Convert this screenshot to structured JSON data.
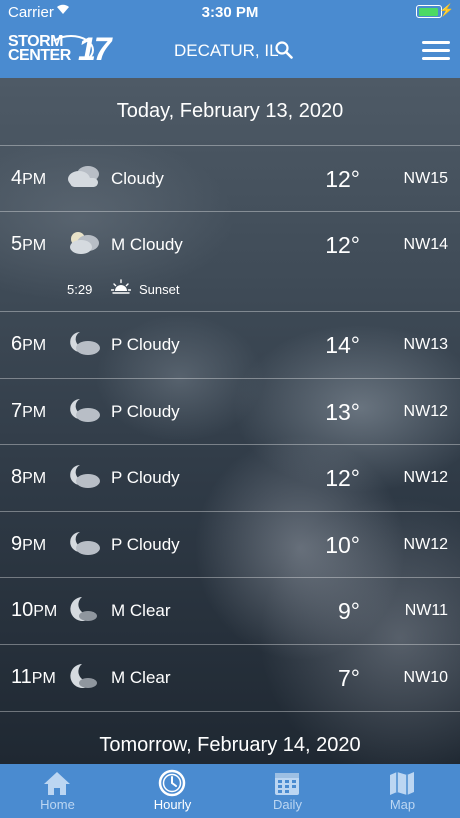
{
  "status": {
    "carrier": "Carrier",
    "time": "3:30 PM"
  },
  "header": {
    "logo_line1": "STORM",
    "logo_line2": "CENTER",
    "logo_number": "17",
    "location": "DECATUR, IL",
    "icons": {
      "search": "search-icon",
      "menu": "menu-icon"
    }
  },
  "today_header": "Today, February 13, 2020",
  "tomorrow_header": "Tomorrow, February 14, 2020",
  "hours": [
    {
      "hour": "4",
      "ampm": "PM",
      "icon": "cloudy-icon",
      "condition": "Cloudy",
      "temp": "12°",
      "wind": "NW15"
    },
    {
      "hour": "5",
      "ampm": "PM",
      "icon": "mostly-cloudy-day-icon",
      "condition": "M Cloudy",
      "temp": "12°",
      "wind": "NW14"
    },
    {
      "hour": "6",
      "ampm": "PM",
      "icon": "partly-cloudy-night-icon",
      "condition": "P Cloudy",
      "temp": "14°",
      "wind": "NW13"
    },
    {
      "hour": "7",
      "ampm": "PM",
      "icon": "partly-cloudy-night-icon",
      "condition": "P Cloudy",
      "temp": "13°",
      "wind": "NW12"
    },
    {
      "hour": "8",
      "ampm": "PM",
      "icon": "partly-cloudy-night-icon",
      "condition": "P Cloudy",
      "temp": "12°",
      "wind": "NW12"
    },
    {
      "hour": "9",
      "ampm": "PM",
      "icon": "partly-cloudy-night-icon",
      "condition": "P Cloudy",
      "temp": "10°",
      "wind": "NW12"
    },
    {
      "hour": "10",
      "ampm": "PM",
      "icon": "mostly-clear-night-icon",
      "condition": "M Clear",
      "temp": "9°",
      "wind": "NW11"
    },
    {
      "hour": "11",
      "ampm": "PM",
      "icon": "mostly-clear-night-icon",
      "condition": "M Clear",
      "temp": "7°",
      "wind": "NW10"
    }
  ],
  "sunset": {
    "time": "5:29",
    "label": "Sunset",
    "icon": "sunset-icon"
  },
  "tabs": [
    {
      "label": "Home",
      "icon": "home-icon",
      "active": false
    },
    {
      "label": "Hourly",
      "icon": "clock-icon",
      "active": true
    },
    {
      "label": "Daily",
      "icon": "calendar-icon",
      "active": false
    },
    {
      "label": "Map",
      "icon": "map-icon",
      "active": false
    }
  ],
  "colors": {
    "bar_blue": "#4a8bd0",
    "tab_inactive": "#bcd6f2",
    "battery_green": "#4cd964"
  }
}
